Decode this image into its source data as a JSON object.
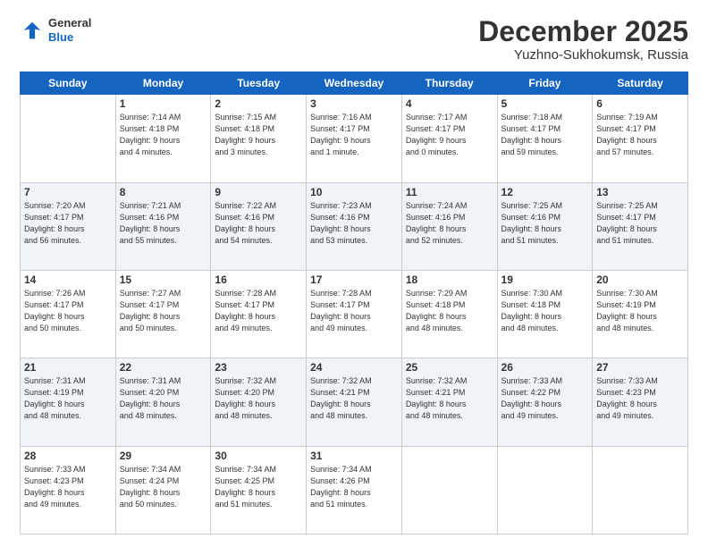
{
  "logo": {
    "line1": "General",
    "line2": "Blue"
  },
  "title": "December 2025",
  "subtitle": "Yuzhno-Sukhokumsk, Russia",
  "days_of_week": [
    "Sunday",
    "Monday",
    "Tuesday",
    "Wednesday",
    "Thursday",
    "Friday",
    "Saturday"
  ],
  "weeks": [
    [
      {
        "num": "",
        "info": ""
      },
      {
        "num": "1",
        "info": "Sunrise: 7:14 AM\nSunset: 4:18 PM\nDaylight: 9 hours\nand 4 minutes."
      },
      {
        "num": "2",
        "info": "Sunrise: 7:15 AM\nSunset: 4:18 PM\nDaylight: 9 hours\nand 3 minutes."
      },
      {
        "num": "3",
        "info": "Sunrise: 7:16 AM\nSunset: 4:17 PM\nDaylight: 9 hours\nand 1 minute."
      },
      {
        "num": "4",
        "info": "Sunrise: 7:17 AM\nSunset: 4:17 PM\nDaylight: 9 hours\nand 0 minutes."
      },
      {
        "num": "5",
        "info": "Sunrise: 7:18 AM\nSunset: 4:17 PM\nDaylight: 8 hours\nand 59 minutes."
      },
      {
        "num": "6",
        "info": "Sunrise: 7:19 AM\nSunset: 4:17 PM\nDaylight: 8 hours\nand 57 minutes."
      }
    ],
    [
      {
        "num": "7",
        "info": "Sunrise: 7:20 AM\nSunset: 4:17 PM\nDaylight: 8 hours\nand 56 minutes."
      },
      {
        "num": "8",
        "info": "Sunrise: 7:21 AM\nSunset: 4:16 PM\nDaylight: 8 hours\nand 55 minutes."
      },
      {
        "num": "9",
        "info": "Sunrise: 7:22 AM\nSunset: 4:16 PM\nDaylight: 8 hours\nand 54 minutes."
      },
      {
        "num": "10",
        "info": "Sunrise: 7:23 AM\nSunset: 4:16 PM\nDaylight: 8 hours\nand 53 minutes."
      },
      {
        "num": "11",
        "info": "Sunrise: 7:24 AM\nSunset: 4:16 PM\nDaylight: 8 hours\nand 52 minutes."
      },
      {
        "num": "12",
        "info": "Sunrise: 7:25 AM\nSunset: 4:16 PM\nDaylight: 8 hours\nand 51 minutes."
      },
      {
        "num": "13",
        "info": "Sunrise: 7:25 AM\nSunset: 4:17 PM\nDaylight: 8 hours\nand 51 minutes."
      }
    ],
    [
      {
        "num": "14",
        "info": "Sunrise: 7:26 AM\nSunset: 4:17 PM\nDaylight: 8 hours\nand 50 minutes."
      },
      {
        "num": "15",
        "info": "Sunrise: 7:27 AM\nSunset: 4:17 PM\nDaylight: 8 hours\nand 50 minutes."
      },
      {
        "num": "16",
        "info": "Sunrise: 7:28 AM\nSunset: 4:17 PM\nDaylight: 8 hours\nand 49 minutes."
      },
      {
        "num": "17",
        "info": "Sunrise: 7:28 AM\nSunset: 4:17 PM\nDaylight: 8 hours\nand 49 minutes."
      },
      {
        "num": "18",
        "info": "Sunrise: 7:29 AM\nSunset: 4:18 PM\nDaylight: 8 hours\nand 48 minutes."
      },
      {
        "num": "19",
        "info": "Sunrise: 7:30 AM\nSunset: 4:18 PM\nDaylight: 8 hours\nand 48 minutes."
      },
      {
        "num": "20",
        "info": "Sunrise: 7:30 AM\nSunset: 4:19 PM\nDaylight: 8 hours\nand 48 minutes."
      }
    ],
    [
      {
        "num": "21",
        "info": "Sunrise: 7:31 AM\nSunset: 4:19 PM\nDaylight: 8 hours\nand 48 minutes."
      },
      {
        "num": "22",
        "info": "Sunrise: 7:31 AM\nSunset: 4:20 PM\nDaylight: 8 hours\nand 48 minutes."
      },
      {
        "num": "23",
        "info": "Sunrise: 7:32 AM\nSunset: 4:20 PM\nDaylight: 8 hours\nand 48 minutes."
      },
      {
        "num": "24",
        "info": "Sunrise: 7:32 AM\nSunset: 4:21 PM\nDaylight: 8 hours\nand 48 minutes."
      },
      {
        "num": "25",
        "info": "Sunrise: 7:32 AM\nSunset: 4:21 PM\nDaylight: 8 hours\nand 48 minutes."
      },
      {
        "num": "26",
        "info": "Sunrise: 7:33 AM\nSunset: 4:22 PM\nDaylight: 8 hours\nand 49 minutes."
      },
      {
        "num": "27",
        "info": "Sunrise: 7:33 AM\nSunset: 4:23 PM\nDaylight: 8 hours\nand 49 minutes."
      }
    ],
    [
      {
        "num": "28",
        "info": "Sunrise: 7:33 AM\nSunset: 4:23 PM\nDaylight: 8 hours\nand 49 minutes."
      },
      {
        "num": "29",
        "info": "Sunrise: 7:34 AM\nSunset: 4:24 PM\nDaylight: 8 hours\nand 50 minutes."
      },
      {
        "num": "30",
        "info": "Sunrise: 7:34 AM\nSunset: 4:25 PM\nDaylight: 8 hours\nand 51 minutes."
      },
      {
        "num": "31",
        "info": "Sunrise: 7:34 AM\nSunset: 4:26 PM\nDaylight: 8 hours\nand 51 minutes."
      },
      {
        "num": "",
        "info": ""
      },
      {
        "num": "",
        "info": ""
      },
      {
        "num": "",
        "info": ""
      }
    ]
  ]
}
